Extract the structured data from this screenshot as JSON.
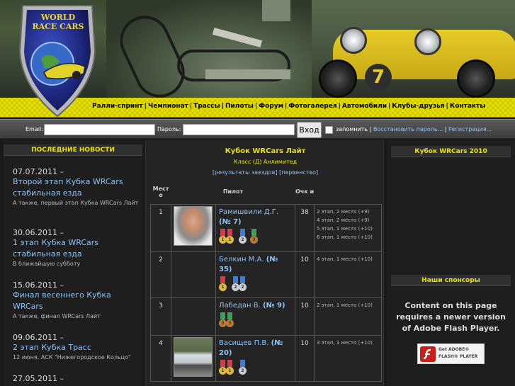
{
  "logo": {
    "text_line1": "WORLD",
    "text_line2": "RACE CARS"
  },
  "header": {
    "car_number": "7"
  },
  "menu": {
    "items": [
      "Ралли-спринт",
      "Чемпионат",
      "Трассы",
      "Пилоты",
      "Форум",
      "Фотогалерея",
      "Автомобили",
      "Клубы-друзья",
      "Контакты"
    ]
  },
  "login": {
    "email_label": "Email:",
    "password_label": "Пароль:",
    "submit_label": "Вход",
    "remember_label": "запомнить",
    "restore_link": "Восстановить пароль...",
    "register_link": "Регистрация..."
  },
  "news": {
    "title": "ПОСЛЕДНИЕ НОВОСТИ",
    "items": [
      {
        "date": "07.07.2011 –",
        "title": "Второй этап Кубка WRCars стабильная езда",
        "desc": "А также, первый этап Кубка WRCars Лайт"
      },
      {
        "date": "30.06.2011 –",
        "title": "1 этап Кубка WRCars стабильная езда",
        "desc": "В ближайшую субботу"
      },
      {
        "date": "15.06.2011 –",
        "title": "Финал весеннего Кубка WRCars",
        "desc": "А также, финал WRCars Лайт"
      },
      {
        "date": "09.06.2011 –",
        "title": "2 этап Кубка Трасс",
        "desc": "12 июня, АСК \"Нижегородское Кольцо\""
      },
      {
        "date": "27.05.2011 –",
        "title": "",
        "desc": ""
      }
    ]
  },
  "cup": {
    "title": "Кубок WRCars Лайт",
    "class_label": "Класс (Д) Анлимитед",
    "results_link": "[результаты заездов]",
    "championship_link": "[первенство]",
    "columns": [
      "Мест о",
      "Пилот",
      "Очк и"
    ],
    "rows": [
      {
        "place": "1",
        "name": "Рамишвили Д.Г.",
        "number": "(№ 7)",
        "points": "38",
        "stages": [
          "2 этап, 2 место (+9)",
          "4 этап, 2 место (+9)",
          "5 этап, 1 место (+10)",
          "6 этап, 1 место (+10)"
        ],
        "medals": [
          "1",
          "1",
          "2",
          "3"
        ],
        "has_photo": "yes"
      },
      {
        "place": "2",
        "name": "Белкин М.А.",
        "number": "(№ 35)",
        "points": "10",
        "stages": [
          "4 этап, 1 место (+10)"
        ],
        "medals": [
          "1",
          "2",
          "2"
        ],
        "has_photo": "no"
      },
      {
        "place": "3",
        "name": "Лабедан В.",
        "number": "(№ 9)",
        "points": "10",
        "stages": [
          "2 этап, 1 место (+10)"
        ],
        "medals": [
          "3",
          "3"
        ],
        "has_photo": "no"
      },
      {
        "place": "4",
        "name": "Васищев П.В.",
        "number": "(№ 20)",
        "points": "10",
        "stages": [
          "3 этап, 1 место (+10)"
        ],
        "medals": [
          "1",
          "1",
          "2"
        ],
        "has_photo": "yes"
      }
    ]
  },
  "right": {
    "wrc2010_title": "Кубок WRCars 2010",
    "sponsors_title": "Наши спонсоры",
    "flash_message": "Content on this page requires a newer version of Adobe Flash Player.",
    "flash_btn_line1": "Get ADOBE®",
    "flash_btn_line2": "FLASH® PLAYER"
  },
  "colors": {
    "accent_yellow": "#e9e200",
    "link_blue": "#8ec3f5",
    "gold": "#e2b93b",
    "silver": "#c7ced6",
    "bronze": "#b87a3d"
  }
}
